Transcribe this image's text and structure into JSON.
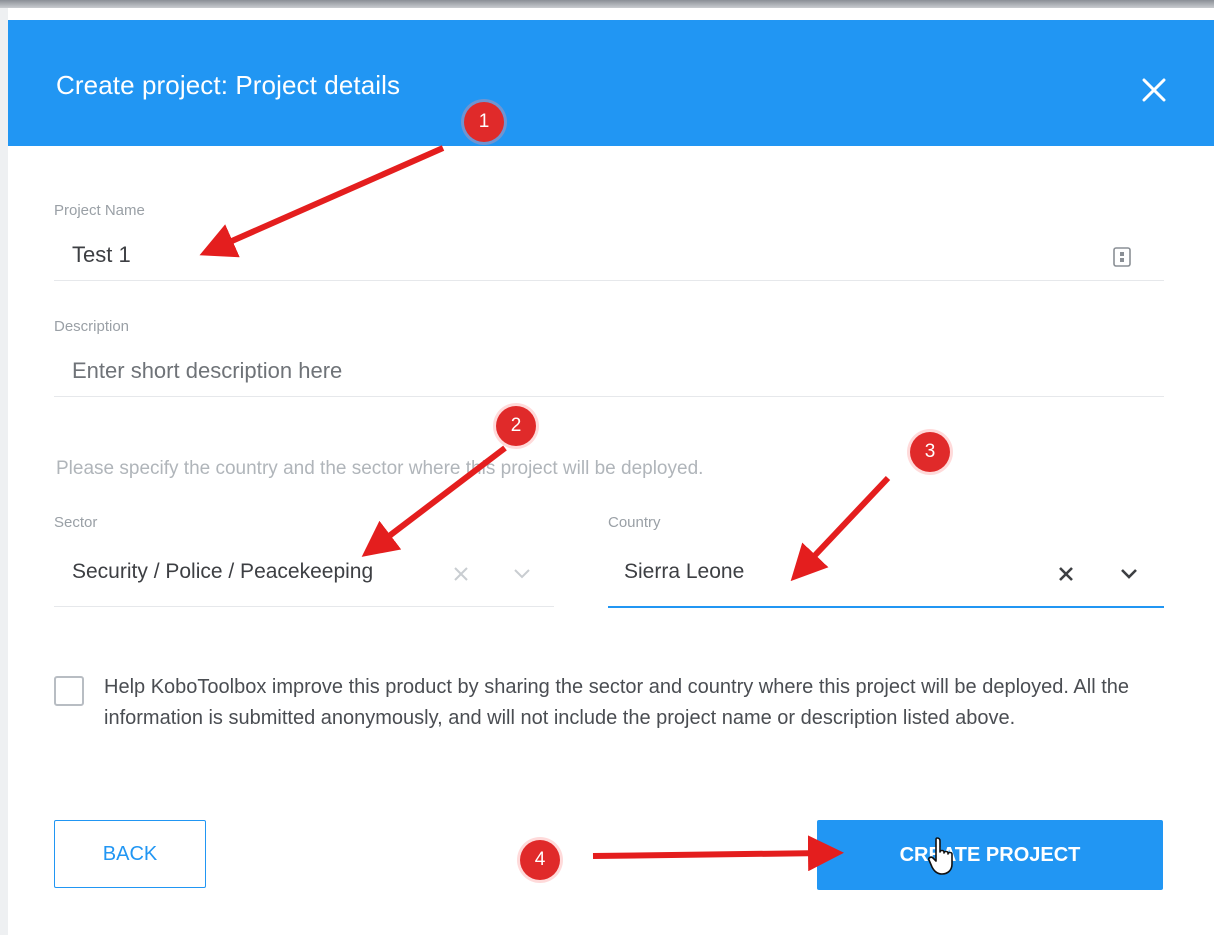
{
  "modal": {
    "title": "Create project: Project details",
    "close_icon": "close-icon"
  },
  "project_name": {
    "label": "Project Name",
    "value": "Test 1",
    "icon": "form-icon"
  },
  "description": {
    "label": "Description",
    "placeholder": "Enter short description here",
    "value": ""
  },
  "hint": "Please specify the country and the sector where this project will be deployed.",
  "sector": {
    "label": "Sector",
    "value": "Security / Police / Peacekeeping"
  },
  "country": {
    "label": "Country",
    "value": "Sierra Leone"
  },
  "consent": {
    "checked": false,
    "text": "Help KoboToolbox improve this product by sharing the sector and country where this project will be deployed. All the information is submitted anonymously, and will not include the project name or description listed above."
  },
  "buttons": {
    "back": "BACK",
    "create": "CREATE PROJECT"
  },
  "annotations": [
    "1",
    "2",
    "3",
    "4"
  ],
  "colors": {
    "primary": "#2196f3",
    "annotation": "#e02a2a"
  }
}
